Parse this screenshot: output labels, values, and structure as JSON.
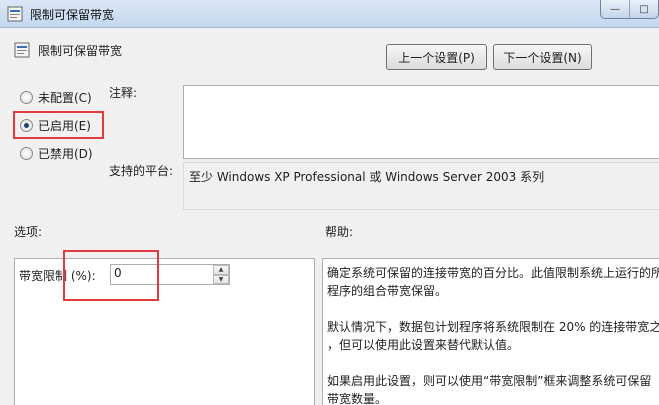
{
  "window": {
    "title": "限制可保留带宽",
    "minimize_glyph": "—",
    "maximize_glyph": "□",
    "close_glyph": "✕"
  },
  "header": {
    "title": "限制可保留带宽",
    "prev_button": "上一个设置(P)",
    "next_button": "下一个设置(N)"
  },
  "state": {
    "options": [
      {
        "label": "未配置(C)",
        "selected": false
      },
      {
        "label": "已启用(E)",
        "selected": true
      },
      {
        "label": "已禁用(D)",
        "selected": false
      }
    ]
  },
  "comment": {
    "label": "注释:",
    "value": ""
  },
  "platform": {
    "label": "支持的平台:",
    "value": "至少 Windows XP Professional 或 Windows Server 2003 系列"
  },
  "options_section": {
    "label": "选项:",
    "bandwidth_label": "带宽限制 (%):",
    "bandwidth_value": "0",
    "spin_up": "▲",
    "spin_down": "▼"
  },
  "help_section": {
    "label": "帮助:",
    "lines": [
      "确定系统可保留的连接带宽的百分比。此值限制系统上运行的所",
      "程序的组合带宽保留。",
      "",
      "默认情况下，数据包计划程序将系统限制在 20% 的连接带宽之",
      "，但可以使用此设置来替代默认值。",
      "",
      "如果启用此设置，则可以使用“带宽限制”框来调整系统可保留",
      "带宽数量。"
    ]
  },
  "colors": {
    "highlight_box": "#e23b3b",
    "dialog_bg": "#f0f0f0",
    "titlebar": "#c4d7ef"
  }
}
